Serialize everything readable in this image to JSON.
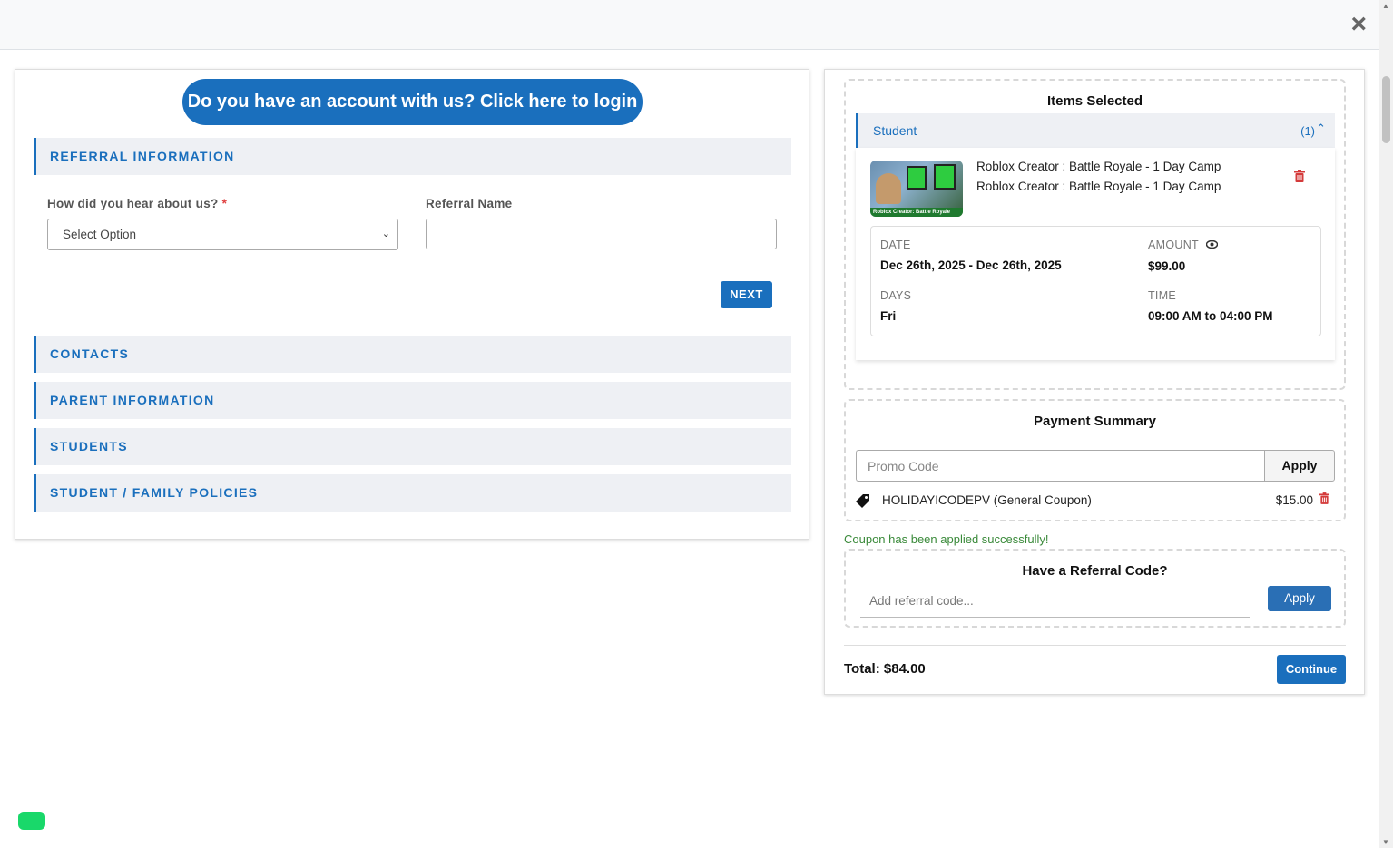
{
  "modal": {
    "close_label": "×"
  },
  "left": {
    "login_button": "Do you have an account with us? Click here to login",
    "sections": {
      "referral": "REFERRAL INFORMATION",
      "contacts": "CONTACTS",
      "parent": "PARENT INFORMATION",
      "students": "STUDENTS",
      "policies": "STUDENT / FAMILY POLICIES"
    },
    "hear_label": "How did you hear about us?",
    "required_mark": "*",
    "hear_select_value": "Select Option",
    "referral_name_label": "Referral Name",
    "referral_name_value": "",
    "next_button": "NEXT"
  },
  "items": {
    "title": "Items Selected",
    "group_label": "Student",
    "group_count": "(1)",
    "item_line1": "Roblox Creator : Battle Royale - 1 Day Camp",
    "item_line2": "Roblox Creator : Battle Royale - 1 Day Camp",
    "thumb_banner": "Roblox Creator: Battle Royale",
    "date_label": "DATE",
    "date_value": "Dec 26th, 2025 - Dec 26th, 2025",
    "amount_label": "AMOUNT",
    "amount_value": "$99.00",
    "days_label": "DAYS",
    "days_value": "Fri",
    "time_label": "TIME",
    "time_value": "09:00 AM to 04:00 PM"
  },
  "payment": {
    "title": "Payment Summary",
    "promo_placeholder": "Promo Code",
    "apply_label": "Apply",
    "coupon_text": "HOLIDAYICODEPV (General Coupon)",
    "coupon_amount": "$15.00",
    "success_message": "Coupon has been applied successfully!"
  },
  "referral_code": {
    "title": "Have a Referral Code?",
    "placeholder": "Add referral code...",
    "apply_label": "Apply"
  },
  "footer": {
    "total": "Total: $84.00",
    "continue_label": "Continue"
  },
  "colors": {
    "primary": "#1a6fbd",
    "danger": "#d43b3b",
    "success": "#3a8a3a",
    "chat": "#19d86a"
  }
}
